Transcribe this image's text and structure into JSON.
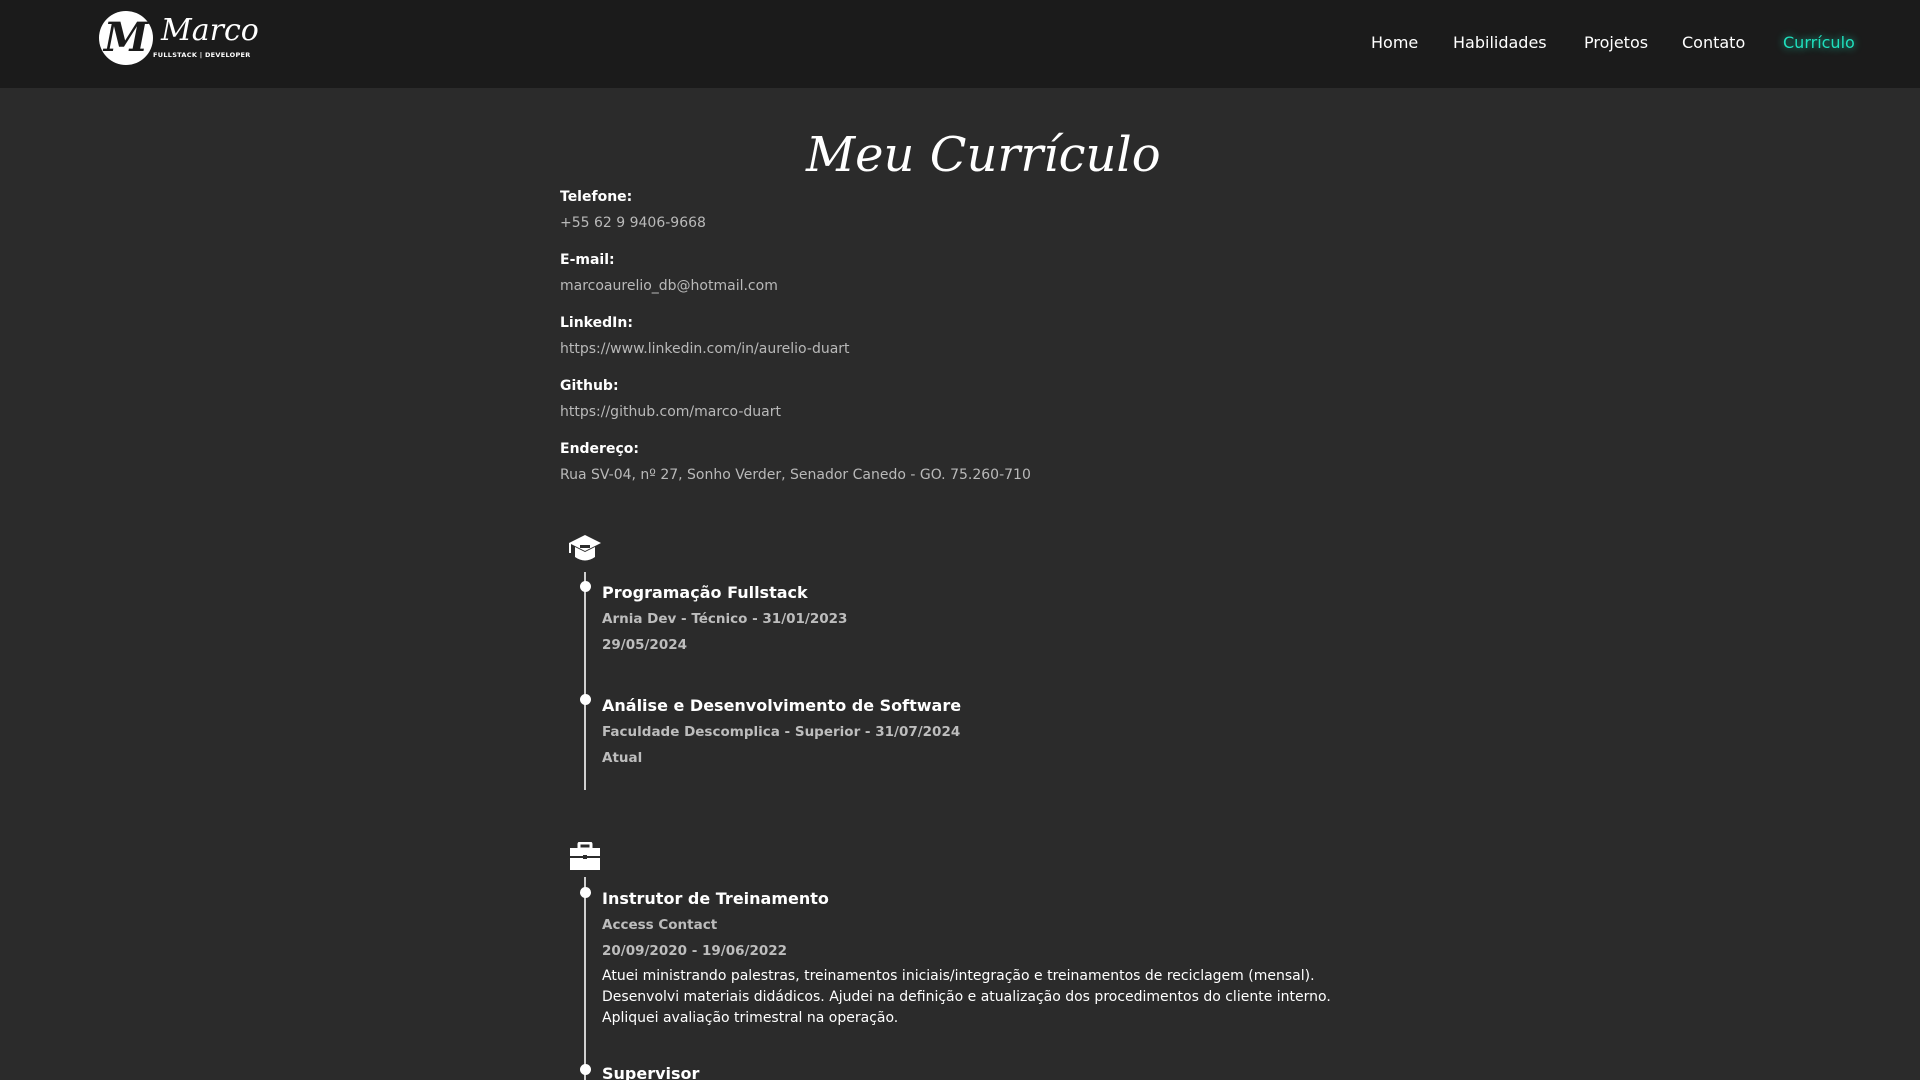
{
  "logo": {
    "monogram": "M",
    "name": "Marco",
    "subtitle": "FULLSTACK | DEVELOPER"
  },
  "nav": {
    "items": [
      "Home",
      "Habilidades",
      "Projetos",
      "Contato",
      "Currículo"
    ],
    "active": "Currículo",
    "active_color": "#1fe0bd"
  },
  "page": {
    "title": "Meu Currículo"
  },
  "contact": [
    {
      "label": "Telefone:",
      "value": "+55 62 9 9406-9668"
    },
    {
      "label": "E-mail:",
      "value": "marcoaurelio_db@hotmail.com"
    },
    {
      "label": "LinkedIn:",
      "value": "https://www.linkedin.com/in/aurelio-duart"
    },
    {
      "label": "Github:",
      "value": "https://github.com/marco-duart"
    },
    {
      "label": "Endereço:",
      "value": "Rua SV-04, nº 27, Sonho Verder, Senador Canedo - GO. 75.260-710"
    }
  ],
  "education": {
    "icon": "graduation-cap-icon",
    "items": [
      {
        "title": "Programação Fullstack",
        "subtitle": "Arnia Dev - Técnico - 31/01/2023",
        "date": "29/05/2024"
      },
      {
        "title": "Análise e Desenvolvimento de Software",
        "subtitle": "Faculdade Descomplica - Superior - 31/07/2024",
        "date": "Atual"
      }
    ]
  },
  "experience": {
    "icon": "briefcase-icon",
    "items": [
      {
        "title": "Instrutor de Treinamento",
        "subtitle": "Access Contact",
        "date": "20/09/2020 - 19/06/2022",
        "description": "Atuei ministrando palestras, treinamentos iniciais/integração e treinamentos de reciclagem (mensal). Desenvolvi materiais didádicos. Ajudei na definição e atualização dos procedimentos do cliente interno. Apliquei avaliação trimestral na operação."
      },
      {
        "title": "Supervisor"
      }
    ]
  }
}
